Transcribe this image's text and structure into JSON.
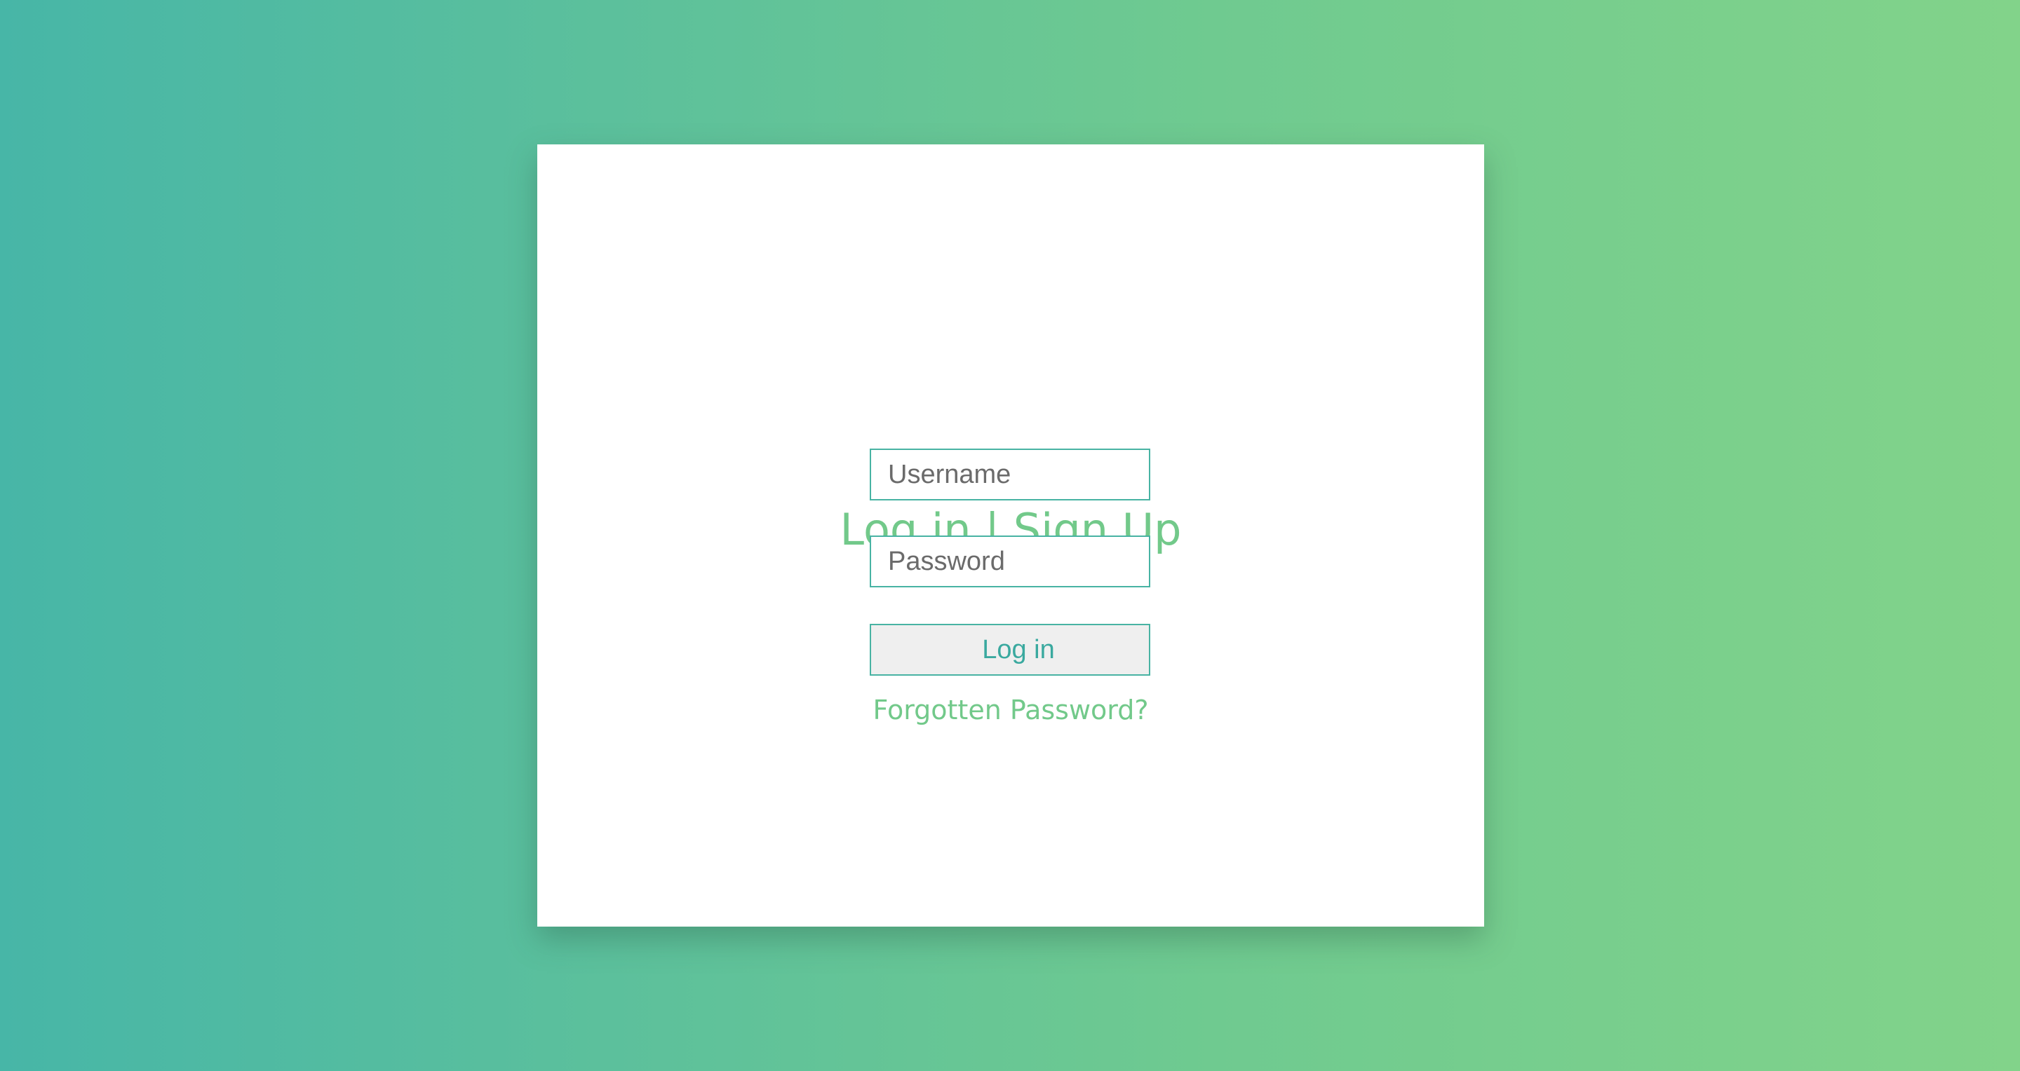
{
  "page": {
    "background_gradient": [
      "#47b6a7",
      "#82d38a"
    ],
    "card_background": "#ffffff"
  },
  "login_form": {
    "title": "Log in | Sign Up",
    "username": {
      "value": "",
      "placeholder": "Username"
    },
    "password": {
      "value": "",
      "placeholder": "Password"
    },
    "login_button_label": "Log in",
    "forgot_password_label": "Forgotten Password?"
  },
  "colors": {
    "accent_green": "#72c98a",
    "accent_teal": "#48b3a3",
    "button_background": "#efefef"
  }
}
